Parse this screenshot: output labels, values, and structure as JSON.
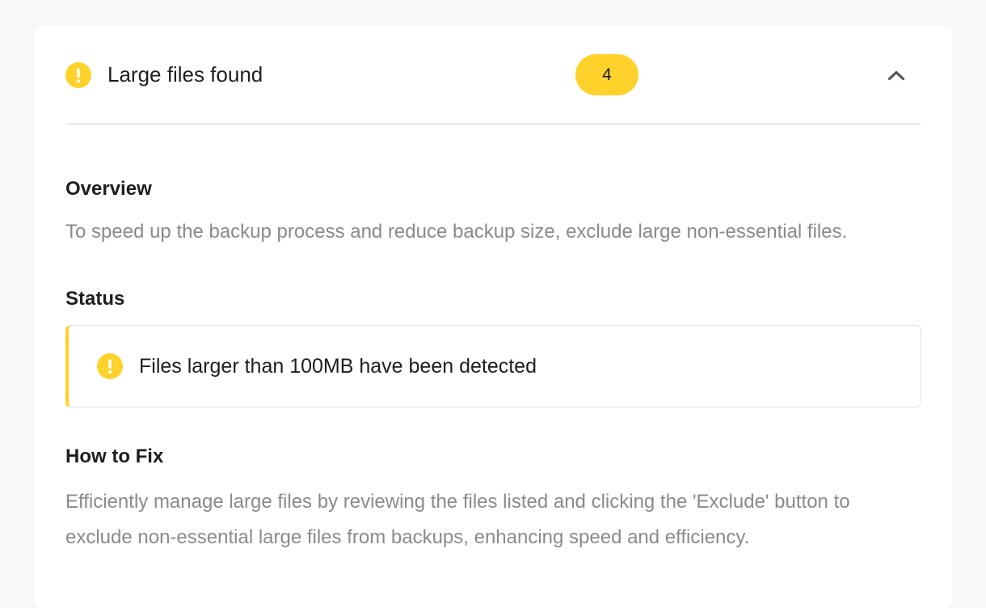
{
  "header": {
    "title": "Large files found",
    "count": "4",
    "icon": "warning-icon",
    "toggle_icon": "chevron-up-icon"
  },
  "overview": {
    "title": "Overview",
    "text": "To speed up the backup process and reduce backup size, exclude large non-essential files."
  },
  "status": {
    "title": "Status",
    "message": "Files larger than 100MB have been detected",
    "icon": "warning-icon"
  },
  "how_to_fix": {
    "title": "How to Fix",
    "text": "Efficiently manage large files by reviewing the files listed and clicking the 'Exclude' button to exclude non-essential large files from backups, enhancing speed and efficiency."
  },
  "colors": {
    "accent": "#ffd12b",
    "text_primary": "#1e1e1e",
    "text_secondary": "#8a8a8a",
    "divider": "#e6e6e6"
  }
}
